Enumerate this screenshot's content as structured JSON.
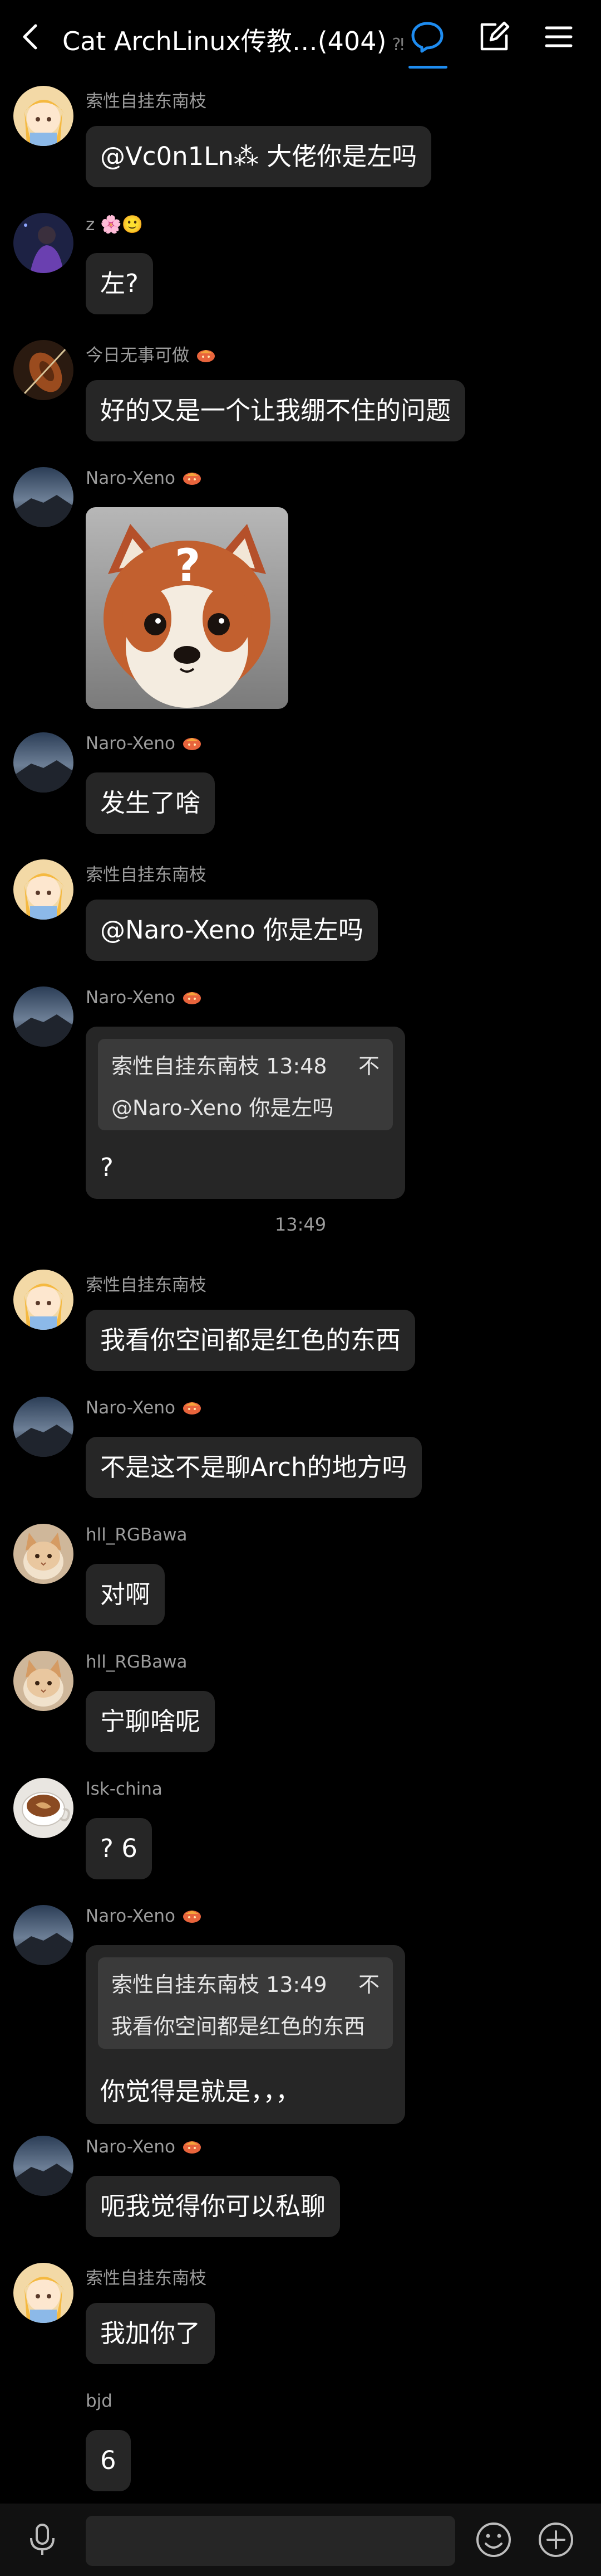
{
  "header": {
    "title": "Cat ArchLinux传教…(404)",
    "accent_color": "#1e8cf0",
    "icons": [
      "back-icon",
      "chat-bubble-icon",
      "edit-icon",
      "menu-icon"
    ]
  },
  "messages": [
    {
      "sender": "索性自挂东南枝",
      "avatar": "cartoon-girl",
      "text": "@Vc0n1Ln⁂ 大佬你是左吗"
    },
    {
      "sender": "z 🌸🙂",
      "avatar": "purple-figure",
      "text": "左?"
    },
    {
      "sender": "今日无事可做",
      "avatar": "violin",
      "text": "好的又是一个让我绷不住的问题"
    },
    {
      "sender": "Naro-Xeno",
      "avatar": "mountain-dusk",
      "image": "red-panda-question",
      "image_text": "?"
    },
    {
      "sender": "Naro-Xeno",
      "avatar": "mountain-dusk",
      "text": "发生了啥"
    },
    {
      "sender": "索性自挂东南枝",
      "avatar": "cartoon-girl",
      "text": "@Naro-Xeno 你是左吗"
    },
    {
      "sender": "Naro-Xeno",
      "avatar": "mountain-dusk",
      "quote": {
        "author": "索性自挂东南枝 13:48",
        "flag": "不",
        "text": "@Naro-Xeno 你是左吗"
      },
      "text": "?"
    },
    {
      "timestamp": "13:49"
    },
    {
      "sender": "索性自挂东南枝",
      "avatar": "cartoon-girl",
      "text": "我看你空间都是红色的东西"
    },
    {
      "sender": "Naro-Xeno",
      "avatar": "mountain-dusk",
      "text": "不是这不是聊Arch的地方吗"
    },
    {
      "sender": "hll_RGBawa",
      "avatar": "cat",
      "text": "对啊"
    },
    {
      "sender": "hll_RGBawa",
      "avatar": "cat",
      "text": "宁聊啥呢"
    },
    {
      "sender": "lsk-china",
      "avatar": "coffee-cup",
      "text": "? 6"
    },
    {
      "sender": "Naro-Xeno",
      "avatar": "mountain-dusk",
      "quote": {
        "author": "索性自挂东南枝 13:49",
        "flag": "不",
        "text": "我看你空间都是红色的东西"
      },
      "text": "你觉得是就是，，，"
    },
    {
      "sender": "Naro-Xeno",
      "avatar": "mountain-dusk",
      "text": "呃我觉得你可以私聊"
    },
    {
      "sender": "索性自挂东南枝",
      "avatar": "cartoon-girl",
      "text": "我加你了"
    },
    {
      "sender": "bjd",
      "avatar": "",
      "text": "6"
    }
  ],
  "composer": {
    "input_value": "",
    "icons": [
      "microphone-icon",
      "emoji-icon",
      "plus-icon"
    ]
  }
}
